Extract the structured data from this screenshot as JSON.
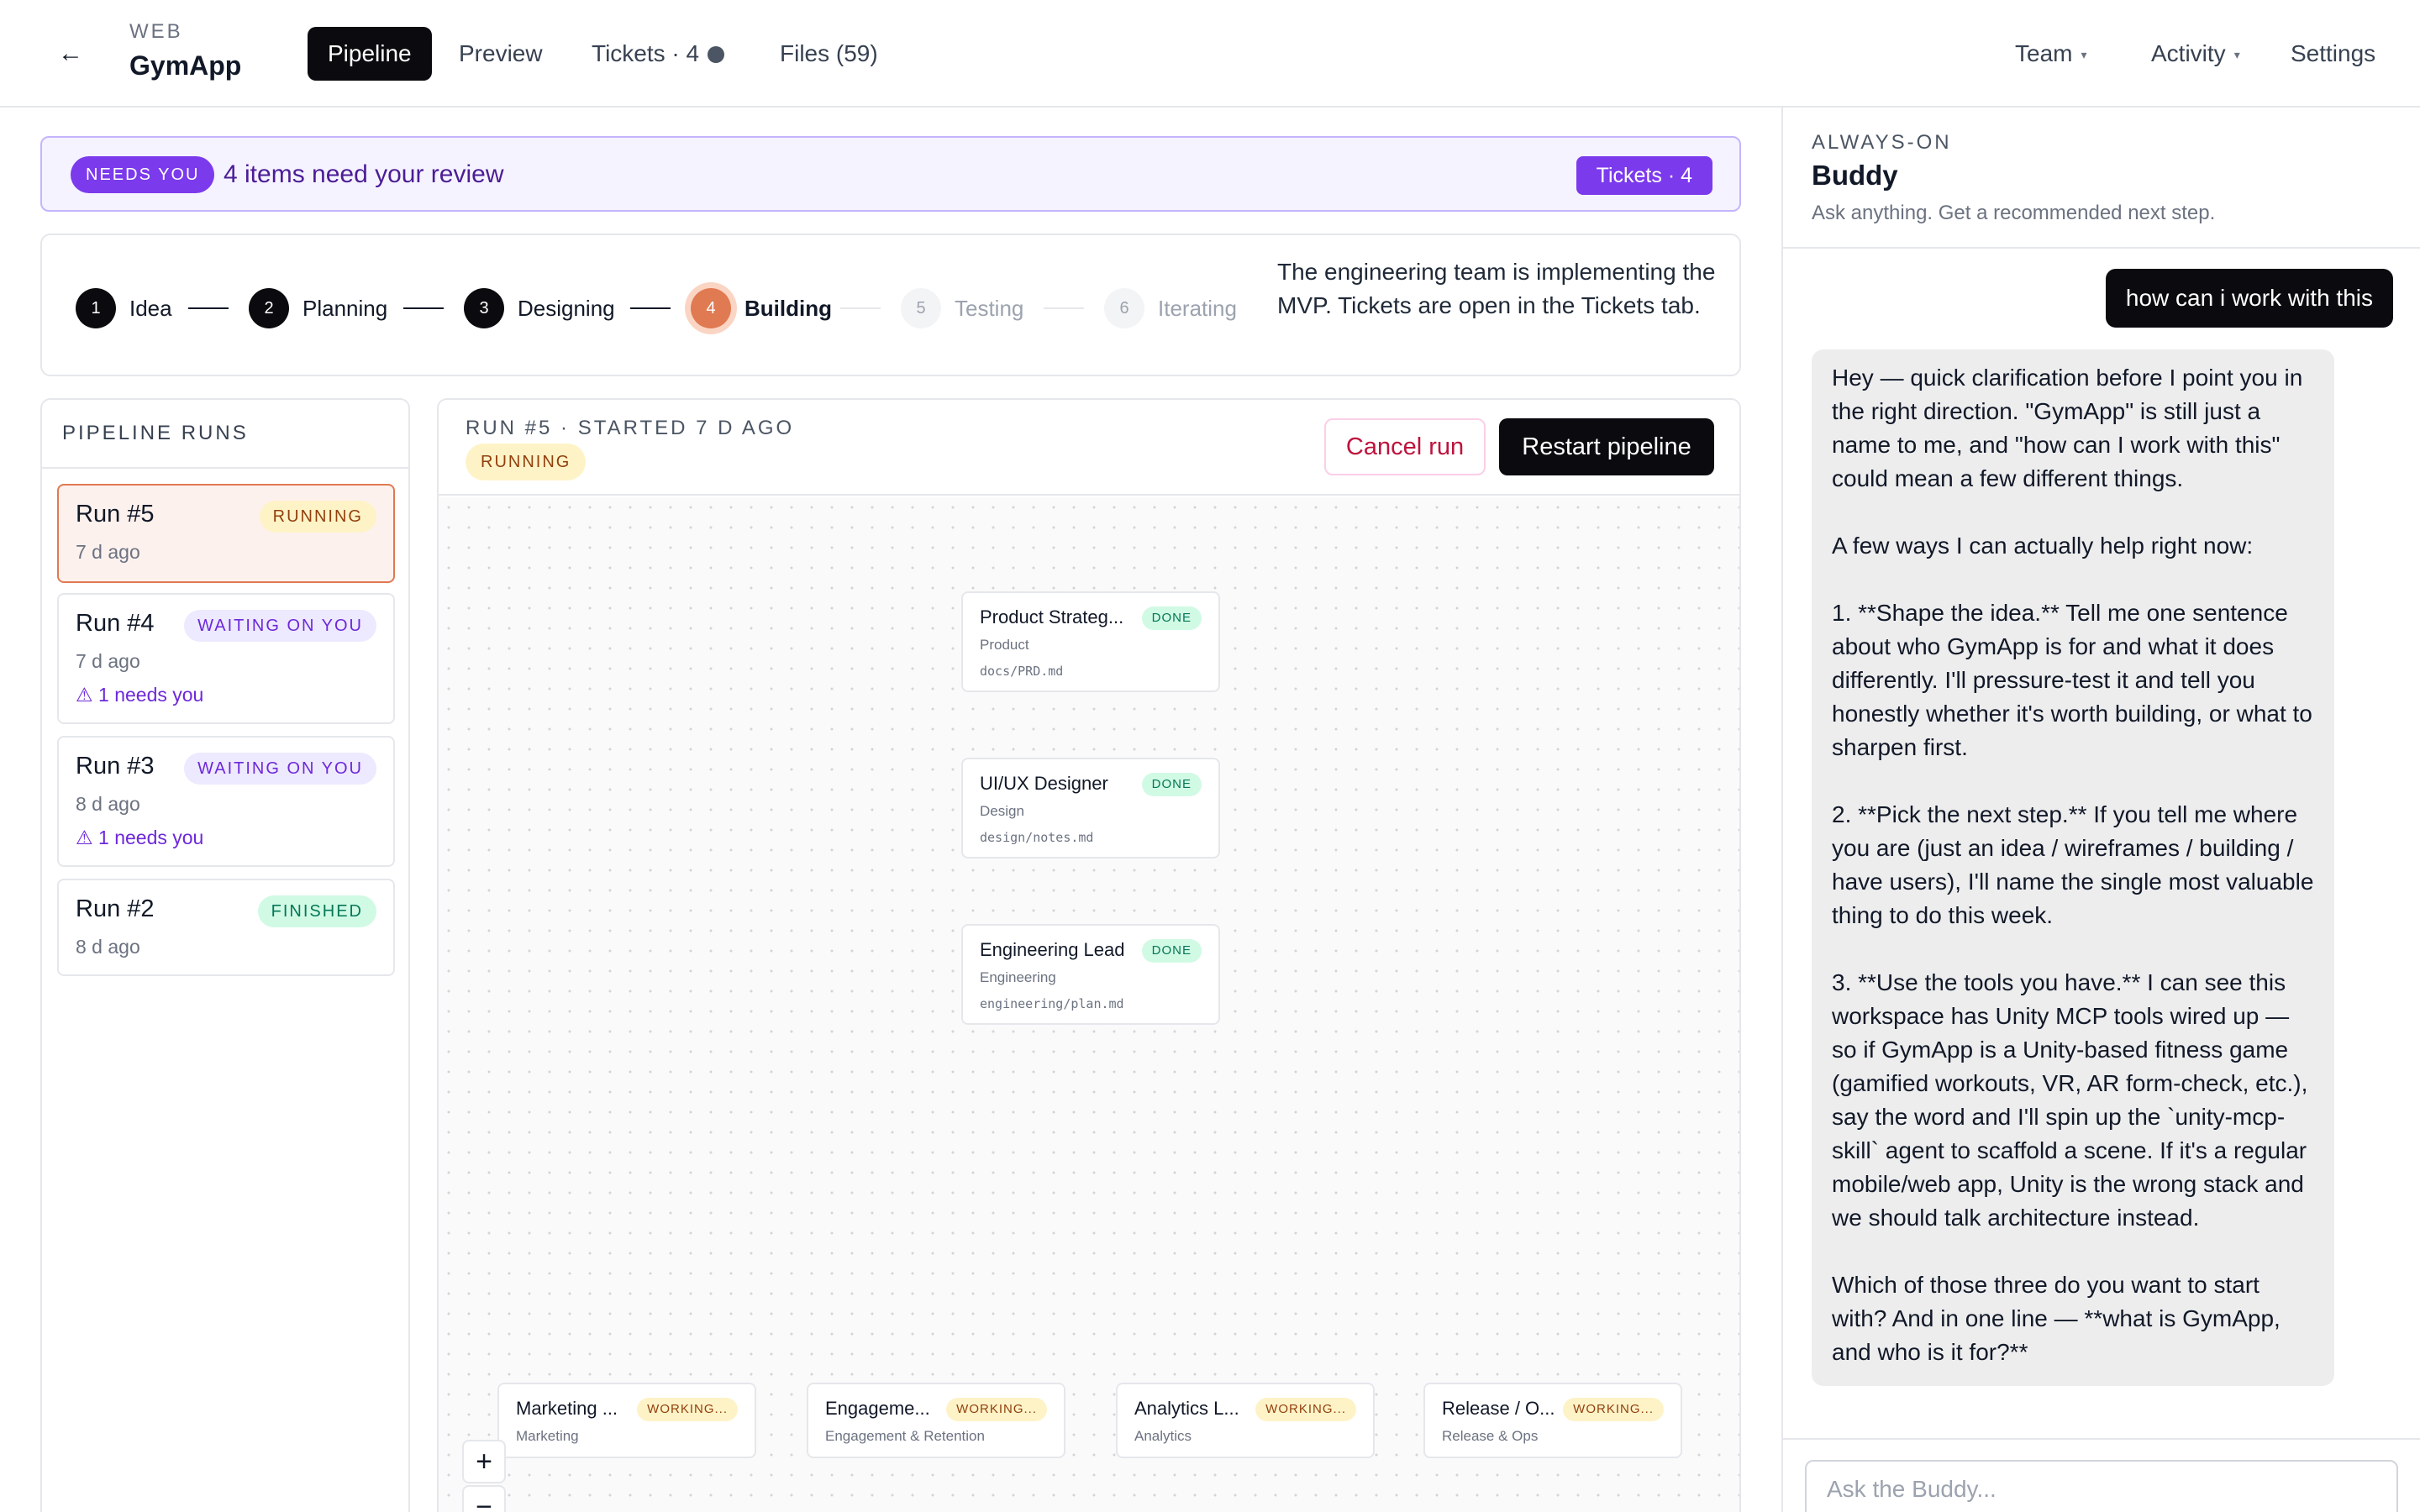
{
  "header": {
    "back_icon": "←",
    "project_kicker": "WEB",
    "project_name": "GymApp",
    "tabs": [
      {
        "label": "Pipeline"
      },
      {
        "label": "Preview"
      },
      {
        "label": "Tickets · 4"
      },
      {
        "label": "Files (59)"
      }
    ],
    "right_nav": [
      {
        "label": "Team"
      },
      {
        "label": "Activity"
      },
      {
        "label": "Settings"
      }
    ],
    "caret_icon": "▾"
  },
  "banner": {
    "badge": "NEEDS YOU",
    "text": "4 items need your review",
    "button": "Tickets · 4"
  },
  "stepper": {
    "steps": [
      {
        "num": "1",
        "label": "Idea"
      },
      {
        "num": "2",
        "label": "Planning"
      },
      {
        "num": "3",
        "label": "Designing"
      },
      {
        "num": "4",
        "label": "Building"
      },
      {
        "num": "5",
        "label": "Testing"
      },
      {
        "num": "6",
        "label": "Iterating"
      }
    ],
    "description": "The engineering team is implementing the MVP. Tickets are open in the Tickets tab."
  },
  "runs": {
    "title": "PIPELINE RUNS",
    "items": [
      {
        "name": "Run #5",
        "status": "RUNNING",
        "time": "7 d ago"
      },
      {
        "name": "Run #4",
        "status": "WAITING ON YOU",
        "time": "7 d ago",
        "needs": "⚠ 1 needs you"
      },
      {
        "name": "Run #3",
        "status": "WAITING ON YOU",
        "time": "8 d ago",
        "needs": "⚠ 1 needs you"
      },
      {
        "name": "Run #2",
        "status": "FINISHED",
        "time": "8 d ago"
      }
    ]
  },
  "main": {
    "title": "RUN #5 · STARTED 7 D AGO",
    "status": "RUNNING",
    "cancel": "Cancel run",
    "restart": "Restart pipeline",
    "nodes": [
      {
        "title": "Product Strateg...",
        "status": "DONE",
        "sub": "Product",
        "file": "docs/PRD.md"
      },
      {
        "title": "UI/UX Designer",
        "status": "DONE",
        "sub": "Design",
        "file": "design/notes.md"
      },
      {
        "title": "Engineering Lead",
        "status": "DONE",
        "sub": "Engineering",
        "file": "engineering/plan.md"
      }
    ],
    "agents": [
      {
        "title": "Marketing ...",
        "status": "WORKING...",
        "sub": "Marketing"
      },
      {
        "title": "Engageme...",
        "status": "WORKING...",
        "sub": "Engagement & Retention"
      },
      {
        "title": "Analytics L...",
        "status": "WORKING...",
        "sub": "Analytics"
      },
      {
        "title": "Release / O...",
        "status": "WORKING...",
        "sub": "Release & Ops"
      }
    ],
    "zoom_in": "+",
    "zoom_out": "−"
  },
  "buddy": {
    "kicker": "ALWAYS-ON",
    "name": "Buddy",
    "subtitle": "Ask anything. Get a recommended next step.",
    "user_message": "how can i work with this",
    "reply": "Hey — quick clarification before I point you in the right direction. \"GymApp\" is still just a name to me, and \"how can I work with this\" could mean a few different things.\n\nA few ways I can actually help right now:\n\n1. **Shape the idea.** Tell me one sentence about who GymApp is for and what it does differently. I'll pressure-test it and tell you honestly whether it's worth building, or what to sharpen first.\n\n2. **Pick the next step.** If you tell me where you are (just an idea / wireframes / building / have users), I'll name the single most valuable thing to do this week.\n\n3. **Use the tools you have.** I can see this workspace has Unity MCP tools wired up — so if GymApp is a Unity-based fitness game (gamified workouts, VR, AR form-check, etc.), say the word and I'll spin up the `unity-mcp-skill` agent to scaffold a scene. If it's a regular mobile/web app, Unity is the wrong stack and we should talk architecture instead.\n\nWhich of those three do you want to start with? And in one line — **what is GymApp, and who is it for?**",
    "input_placeholder": "Ask the Buddy..."
  }
}
